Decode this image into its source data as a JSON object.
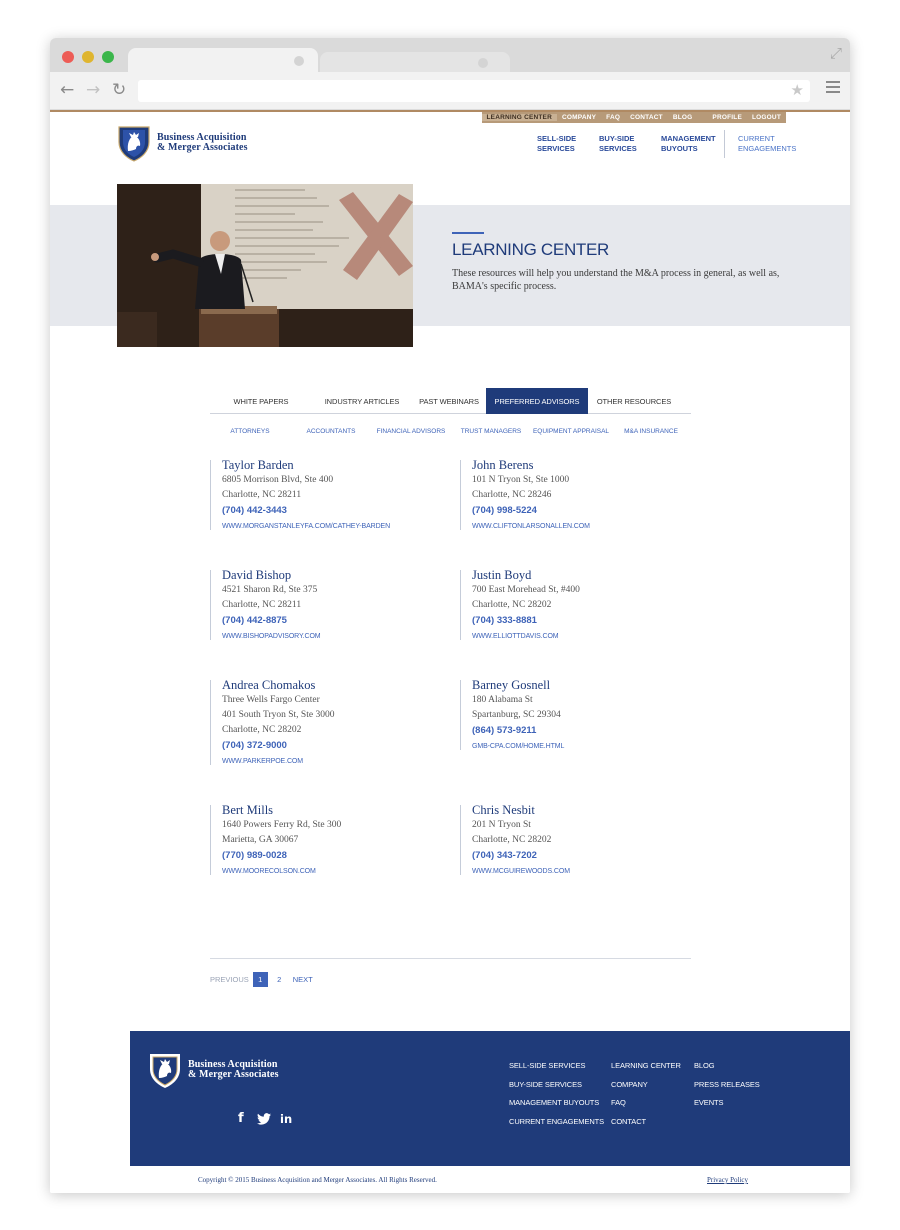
{
  "browser": {
    "colors": {
      "close": "#ed5c56",
      "minimize": "#dfb52f",
      "maximize": "#3bb64b"
    },
    "icons": {
      "back": "back-arrow-icon",
      "forward": "forward-arrow-icon",
      "reload": "reload-icon",
      "bookmark": "star-icon",
      "menu": "hamburger-menu-icon",
      "fullscreen": "fullscreen-icon"
    }
  },
  "site": {
    "utility_nav": [
      "LEARNING CENTER",
      "COMPANY",
      "FAQ",
      "CONTACT",
      "BLOG",
      "PROFILE",
      "LOGOUT"
    ],
    "logo": {
      "line1": "Business Acquisition",
      "line2": "& Merger Associates"
    },
    "main_nav": [
      {
        "line1": "SELL-SIDE",
        "line2": "SERVICES"
      },
      {
        "line1": "BUY-SIDE",
        "line2": "SERVICES"
      },
      {
        "line1": "MANAGEMENT",
        "line2": "BUYOUTS"
      },
      {
        "line1": "CURRENT",
        "line2": "ENGAGEMENTS"
      }
    ],
    "hero": {
      "title": "LEARNING CENTER",
      "description": "These resources will help you understand the M&A process in general, as well as, BAMA's specific process."
    },
    "tabs": [
      "WHITE PAPERS",
      "INDUSTRY ARTICLES",
      "PAST WEBINARS",
      "PREFERRED ADVISORS",
      "OTHER RESOURCES"
    ],
    "active_tab": "PREFERRED ADVISORS",
    "subtabs": [
      "ATTORNEYS",
      "ACCOUNTANTS",
      "FINANCIAL ADVISORS",
      "TRUST MANAGERS",
      "EQUIPMENT APPRAISAL",
      "M&A INSURANCE"
    ],
    "advisors": [
      {
        "name": "Taylor Barden",
        "address": [
          "6805 Morrison Blvd, Ste 400",
          "Charlotte, NC 28211"
        ],
        "phone": "(704) 442-3443",
        "website": "WWW.MORGANSTANLEYFA.COM/CATHEY-BARDEN"
      },
      {
        "name": "John Berens",
        "address": [
          "101 N Tryon St, Ste 1000",
          "Charlotte, NC 28246"
        ],
        "phone": "(704) 998-5224",
        "website": "WWW.CLIFTONLARSONALLEN.COM"
      },
      {
        "name": "David Bishop",
        "address": [
          "4521 Sharon Rd, Ste 375",
          "Charlotte, NC 28211"
        ],
        "phone": "(704) 442-8875",
        "website": "WWW.BISHOPADVISORY.COM"
      },
      {
        "name": "Justin Boyd",
        "address": [
          "700 East Morehead St, #400",
          "Charlotte, NC 28202"
        ],
        "phone": "(704) 333-8881",
        "website": "WWW.ELLIOTTDAVIS.COM"
      },
      {
        "name": "Andrea Chomakos",
        "address": [
          "Three Wells Fargo Center",
          "401 South Tryon St, Ste 3000",
          "Charlotte, NC 28202"
        ],
        "phone": "(704) 372-9000",
        "website": "WWW.PARKERPOE.COM"
      },
      {
        "name": "Barney Gosnell",
        "address": [
          "180 Alabama St",
          "Spartanburg, SC 29304"
        ],
        "phone": "(864) 573-9211",
        "website": "GMB-CPA.COM/HOME.HTML"
      },
      {
        "name": "Bert Mills",
        "address": [
          "1640 Powers Ferry Rd, Ste 300",
          "Marietta, GA 30067"
        ],
        "phone": "(770) 989-0028",
        "website": "WWW.MOORECOLSON.COM"
      },
      {
        "name": "Chris Nesbit",
        "address": [
          "201 N Tryon St",
          "Charlotte, NC 28202"
        ],
        "phone": "(704) 343-7202",
        "website": "WWW.MCGUIREWOODS.COM"
      }
    ],
    "pagination": {
      "previous": "PREVIOUS",
      "pages": [
        "1",
        "2"
      ],
      "current": "1",
      "next": "NEXT"
    },
    "footer": {
      "col1": [
        "SELL-SIDE SERVICES",
        "BUY-SIDE SERVICES",
        "MANAGEMENT BUYOUTS",
        "CURRENT ENGAGEMENTS"
      ],
      "col2": [
        "LEARNING CENTER",
        "COMPANY",
        "FAQ",
        "CONTACT"
      ],
      "col3": [
        "BLOG",
        "PRESS RELEASES",
        "EVENTS"
      ],
      "social": [
        {
          "icon": "facebook-icon",
          "glyph": "f"
        },
        {
          "icon": "twitter-icon",
          "glyph": "t"
        },
        {
          "icon": "linkedin-icon",
          "glyph": "in"
        }
      ],
      "copyright": "Copyright © 2015 Business Acquisition and Merger Associates. All Rights Reserved.",
      "privacy": "Privacy Policy"
    },
    "colors": {
      "brand_navy": "#1f3b7a",
      "link_blue": "#3e63b8",
      "utility_tan": "#b79a79",
      "hero_band": "#e6e8ed"
    }
  }
}
